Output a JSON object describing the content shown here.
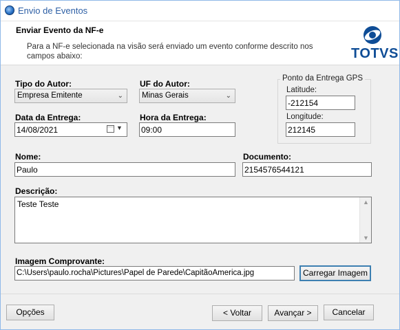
{
  "window": {
    "title": "Envio de Eventos"
  },
  "header": {
    "title": "Enviar Evento da NF-e",
    "description": "Para a NF-e selecionada na visão será enviado um evento conforme descrito nos campos abaixo:",
    "logo_text": "TOTVS"
  },
  "form": {
    "tipo_autor": {
      "label": "Tipo do Autor:",
      "value": "Empresa Emitente"
    },
    "uf_autor": {
      "label": "UF do Autor:",
      "value": "Minas Gerais"
    },
    "data_entrega": {
      "label": "Data da Entrega:",
      "value": "14/08/2021"
    },
    "hora_entrega": {
      "label": "Hora da Entrega:",
      "value": "09:00"
    },
    "gps": {
      "title": "Ponto da Entrega GPS",
      "latitude_label": "Latitude:",
      "latitude_value": "-212154",
      "longitude_label": "Longitude:",
      "longitude_value": "212145"
    },
    "nome": {
      "label": "Nome:",
      "value": "Paulo"
    },
    "documento": {
      "label": "Documento:",
      "value": "2154576544121"
    },
    "descricao": {
      "label": "Descrição:",
      "value": "Teste Teste"
    },
    "imagem": {
      "label": "Imagem Comprovante:",
      "value": "C:\\Users\\paulo.rocha\\Pictures\\Papel de Parede\\CapitãoAmerica.jpg",
      "button_label": "Carregar Imagem"
    }
  },
  "footer": {
    "opcoes_label": "Opções",
    "voltar_label": "< Voltar",
    "avancar_label": "Avançar >",
    "cancelar_label": "Cancelar"
  },
  "colors": {
    "title_text": "#2d5fa5",
    "brand": "#0f4d96"
  }
}
